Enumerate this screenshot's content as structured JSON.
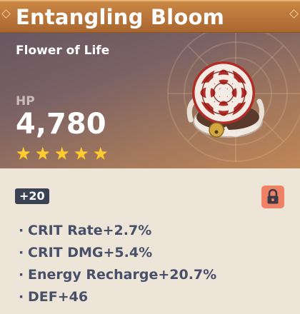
{
  "artifact": {
    "name": "Entangling Bloom",
    "type": "Flower of Life",
    "main_stat": {
      "name": "HP",
      "value": "4,780"
    },
    "rarity": 5,
    "stars": [
      "★",
      "★",
      "★",
      "★",
      "★"
    ],
    "level": "+20",
    "locked": true,
    "icon": "artifact-knot-flower-icon",
    "substat_bullet": "·",
    "substats": [
      {
        "text": "CRIT Rate+2.7%"
      },
      {
        "text": "CRIT DMG+5.4%"
      },
      {
        "text": "Energy Recharge+20.7%"
      },
      {
        "text": "DEF+46"
      }
    ]
  },
  "colors": {
    "title_bar": "#b8743a",
    "star": "#ffcc32",
    "badge_bg": "#3b4254",
    "lock_bg": "#f08066",
    "substat_text": "#485069",
    "body_bg": "#ece5d8"
  }
}
